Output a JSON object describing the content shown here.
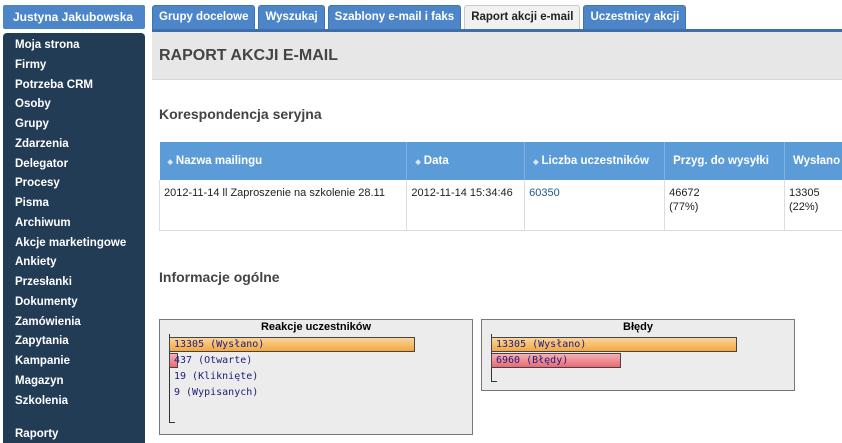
{
  "user": {
    "name": "Justyna Jakubowska"
  },
  "sidebar": {
    "items": [
      {
        "label": "Moja strona"
      },
      {
        "label": "Firmy"
      },
      {
        "label": "Potrzeba CRM"
      },
      {
        "label": "Osoby"
      },
      {
        "label": "Grupy"
      },
      {
        "label": "Zdarzenia"
      },
      {
        "label": "Delegator"
      },
      {
        "label": "Procesy"
      },
      {
        "label": "Pisma"
      },
      {
        "label": "Archiwum"
      },
      {
        "label": "Akcje marketingowe"
      },
      {
        "label": "Ankiety"
      },
      {
        "label": "Przesłanki"
      },
      {
        "label": "Dokumenty"
      },
      {
        "label": "Zamówienia"
      },
      {
        "label": "Zapytania"
      },
      {
        "label": "Kampanie"
      },
      {
        "label": "Magazyn"
      },
      {
        "label": "Szkolenia"
      },
      {
        "label": "Raporty"
      }
    ]
  },
  "tabs": [
    {
      "label": "Grupy docelowe"
    },
    {
      "label": "Wyszukaj"
    },
    {
      "label": "Szablony e-mail i faks"
    },
    {
      "label": "Raport akcji e-mail",
      "active": true
    },
    {
      "label": "Uczestnicy akcji"
    }
  ],
  "page": {
    "title": "RAPORT AKCJI E-MAIL",
    "section1": "Korespondencja seryjna",
    "section2": "Informacje ogólne"
  },
  "table": {
    "headers": [
      "Nazwa mailingu",
      "Data",
      "Liczba uczestników",
      "Przyg. do wysyłki",
      "Wysłano"
    ],
    "row": {
      "name": "2012-11-14 ll Zaproszenie na szkolenie 28.11",
      "date": "2012-11-14 15:34:46",
      "participants": "60350",
      "prepared": "46672",
      "prepared_pct": "(77%)",
      "sent": "13305",
      "sent_pct": "(22%)"
    }
  },
  "charts": {
    "reactions": {
      "title": "Reakcje uczestników",
      "bars": [
        {
          "label": "13305 (Wysłano)",
          "value": 13305,
          "color": "orange"
        },
        {
          "label": "437 (Otwarte)",
          "value": 437,
          "color": "red"
        },
        {
          "label": "19 (Kliknięte)",
          "value": 19,
          "color": "none"
        },
        {
          "label": "9 (Wypisanych)",
          "value": 9,
          "color": "none"
        }
      ]
    },
    "errors": {
      "title": "Błędy",
      "bars": [
        {
          "label": "13305 (Wysłano)",
          "value": 13305,
          "color": "orange"
        },
        {
          "label": "6960 (Błędy)",
          "value": 6960,
          "color": "red"
        }
      ]
    }
  }
}
